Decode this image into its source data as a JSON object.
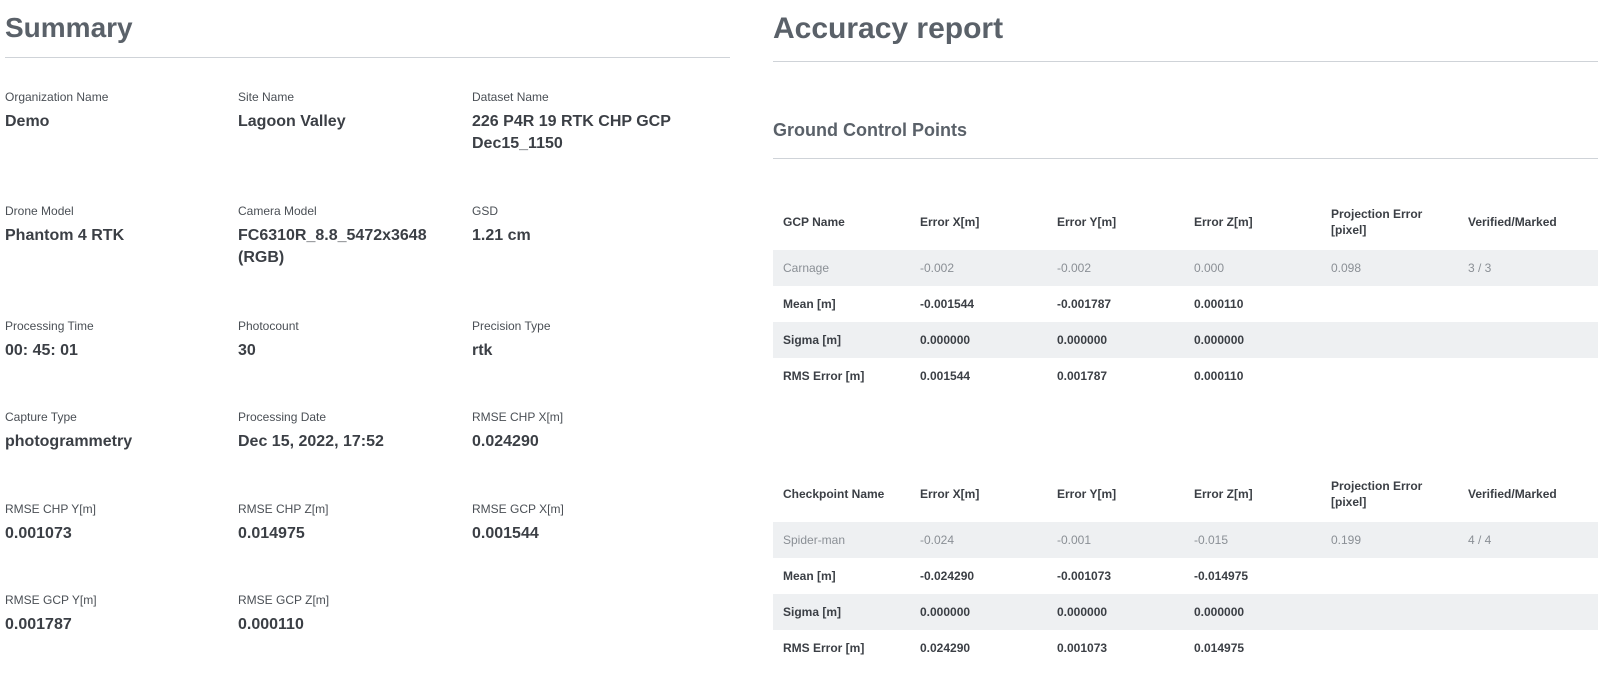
{
  "summary": {
    "title": "Summary",
    "fields": [
      {
        "label": "Organization Name",
        "value": "Demo"
      },
      {
        "label": "Site Name",
        "value": "Lagoon Valley"
      },
      {
        "label": "Dataset Name",
        "value": "226 P4R 19 RTK CHP GCP Dec15_1150"
      },
      {
        "label": "Drone Model",
        "value": "Phantom 4 RTK"
      },
      {
        "label": "Camera Model",
        "value": "FC6310R_8.8_5472x3648 (RGB)"
      },
      {
        "label": "GSD",
        "value": "1.21 cm"
      },
      {
        "label": "Processing Time",
        "value": "00: 45: 01"
      },
      {
        "label": "Photocount",
        "value": "30"
      },
      {
        "label": "Precision Type",
        "value": "rtk"
      },
      {
        "label": "Capture Type",
        "value": "photogrammetry"
      },
      {
        "label": "Processing Date",
        "value": "Dec 15, 2022, 17:52"
      },
      {
        "label": "RMSE CHP X[m]",
        "value": "0.024290"
      },
      {
        "label": "RMSE CHP Y[m]",
        "value": "0.001073"
      },
      {
        "label": "RMSE CHP Z[m]",
        "value": "0.014975"
      },
      {
        "label": "RMSE GCP X[m]",
        "value": "0.001544"
      },
      {
        "label": "RMSE GCP Y[m]",
        "value": "0.001787"
      },
      {
        "label": "RMSE GCP Z[m]",
        "value": "0.000110"
      }
    ]
  },
  "accuracy": {
    "title": "Accuracy report",
    "subtitle": "Ground Control Points",
    "gcp_table": {
      "headers": [
        "GCP Name",
        "Error X[m]",
        "Error Y[m]",
        "Error Z[m]",
        "Projection Error [pixel]",
        "Verified/Marked"
      ],
      "point": [
        "Carnage",
        "-0.002",
        "-0.002",
        "0.000",
        "0.098",
        "3 / 3"
      ],
      "mean": [
        "Mean [m]",
        "-0.001544",
        "-0.001787",
        "0.000110"
      ],
      "sigma": [
        "Sigma [m]",
        "0.000000",
        "0.000000",
        "0.000000"
      ],
      "rms": [
        "RMS Error [m]",
        "0.001544",
        "0.001787",
        "0.000110"
      ]
    },
    "chp_table": {
      "headers": [
        "Checkpoint Name",
        "Error X[m]",
        "Error Y[m]",
        "Error Z[m]",
        "Projection Error [pixel]",
        "Verified/Marked"
      ],
      "point": [
        "Spider-man",
        "-0.024",
        "-0.001",
        "-0.015",
        "0.199",
        "4 / 4"
      ],
      "mean": [
        "Mean [m]",
        "-0.024290",
        "-0.001073",
        "-0.014975"
      ],
      "sigma": [
        "Sigma [m]",
        "0.000000",
        "0.000000",
        "0.000000"
      ],
      "rms": [
        "RMS Error [m]",
        "0.024290",
        "0.001073",
        "0.014975"
      ]
    }
  }
}
